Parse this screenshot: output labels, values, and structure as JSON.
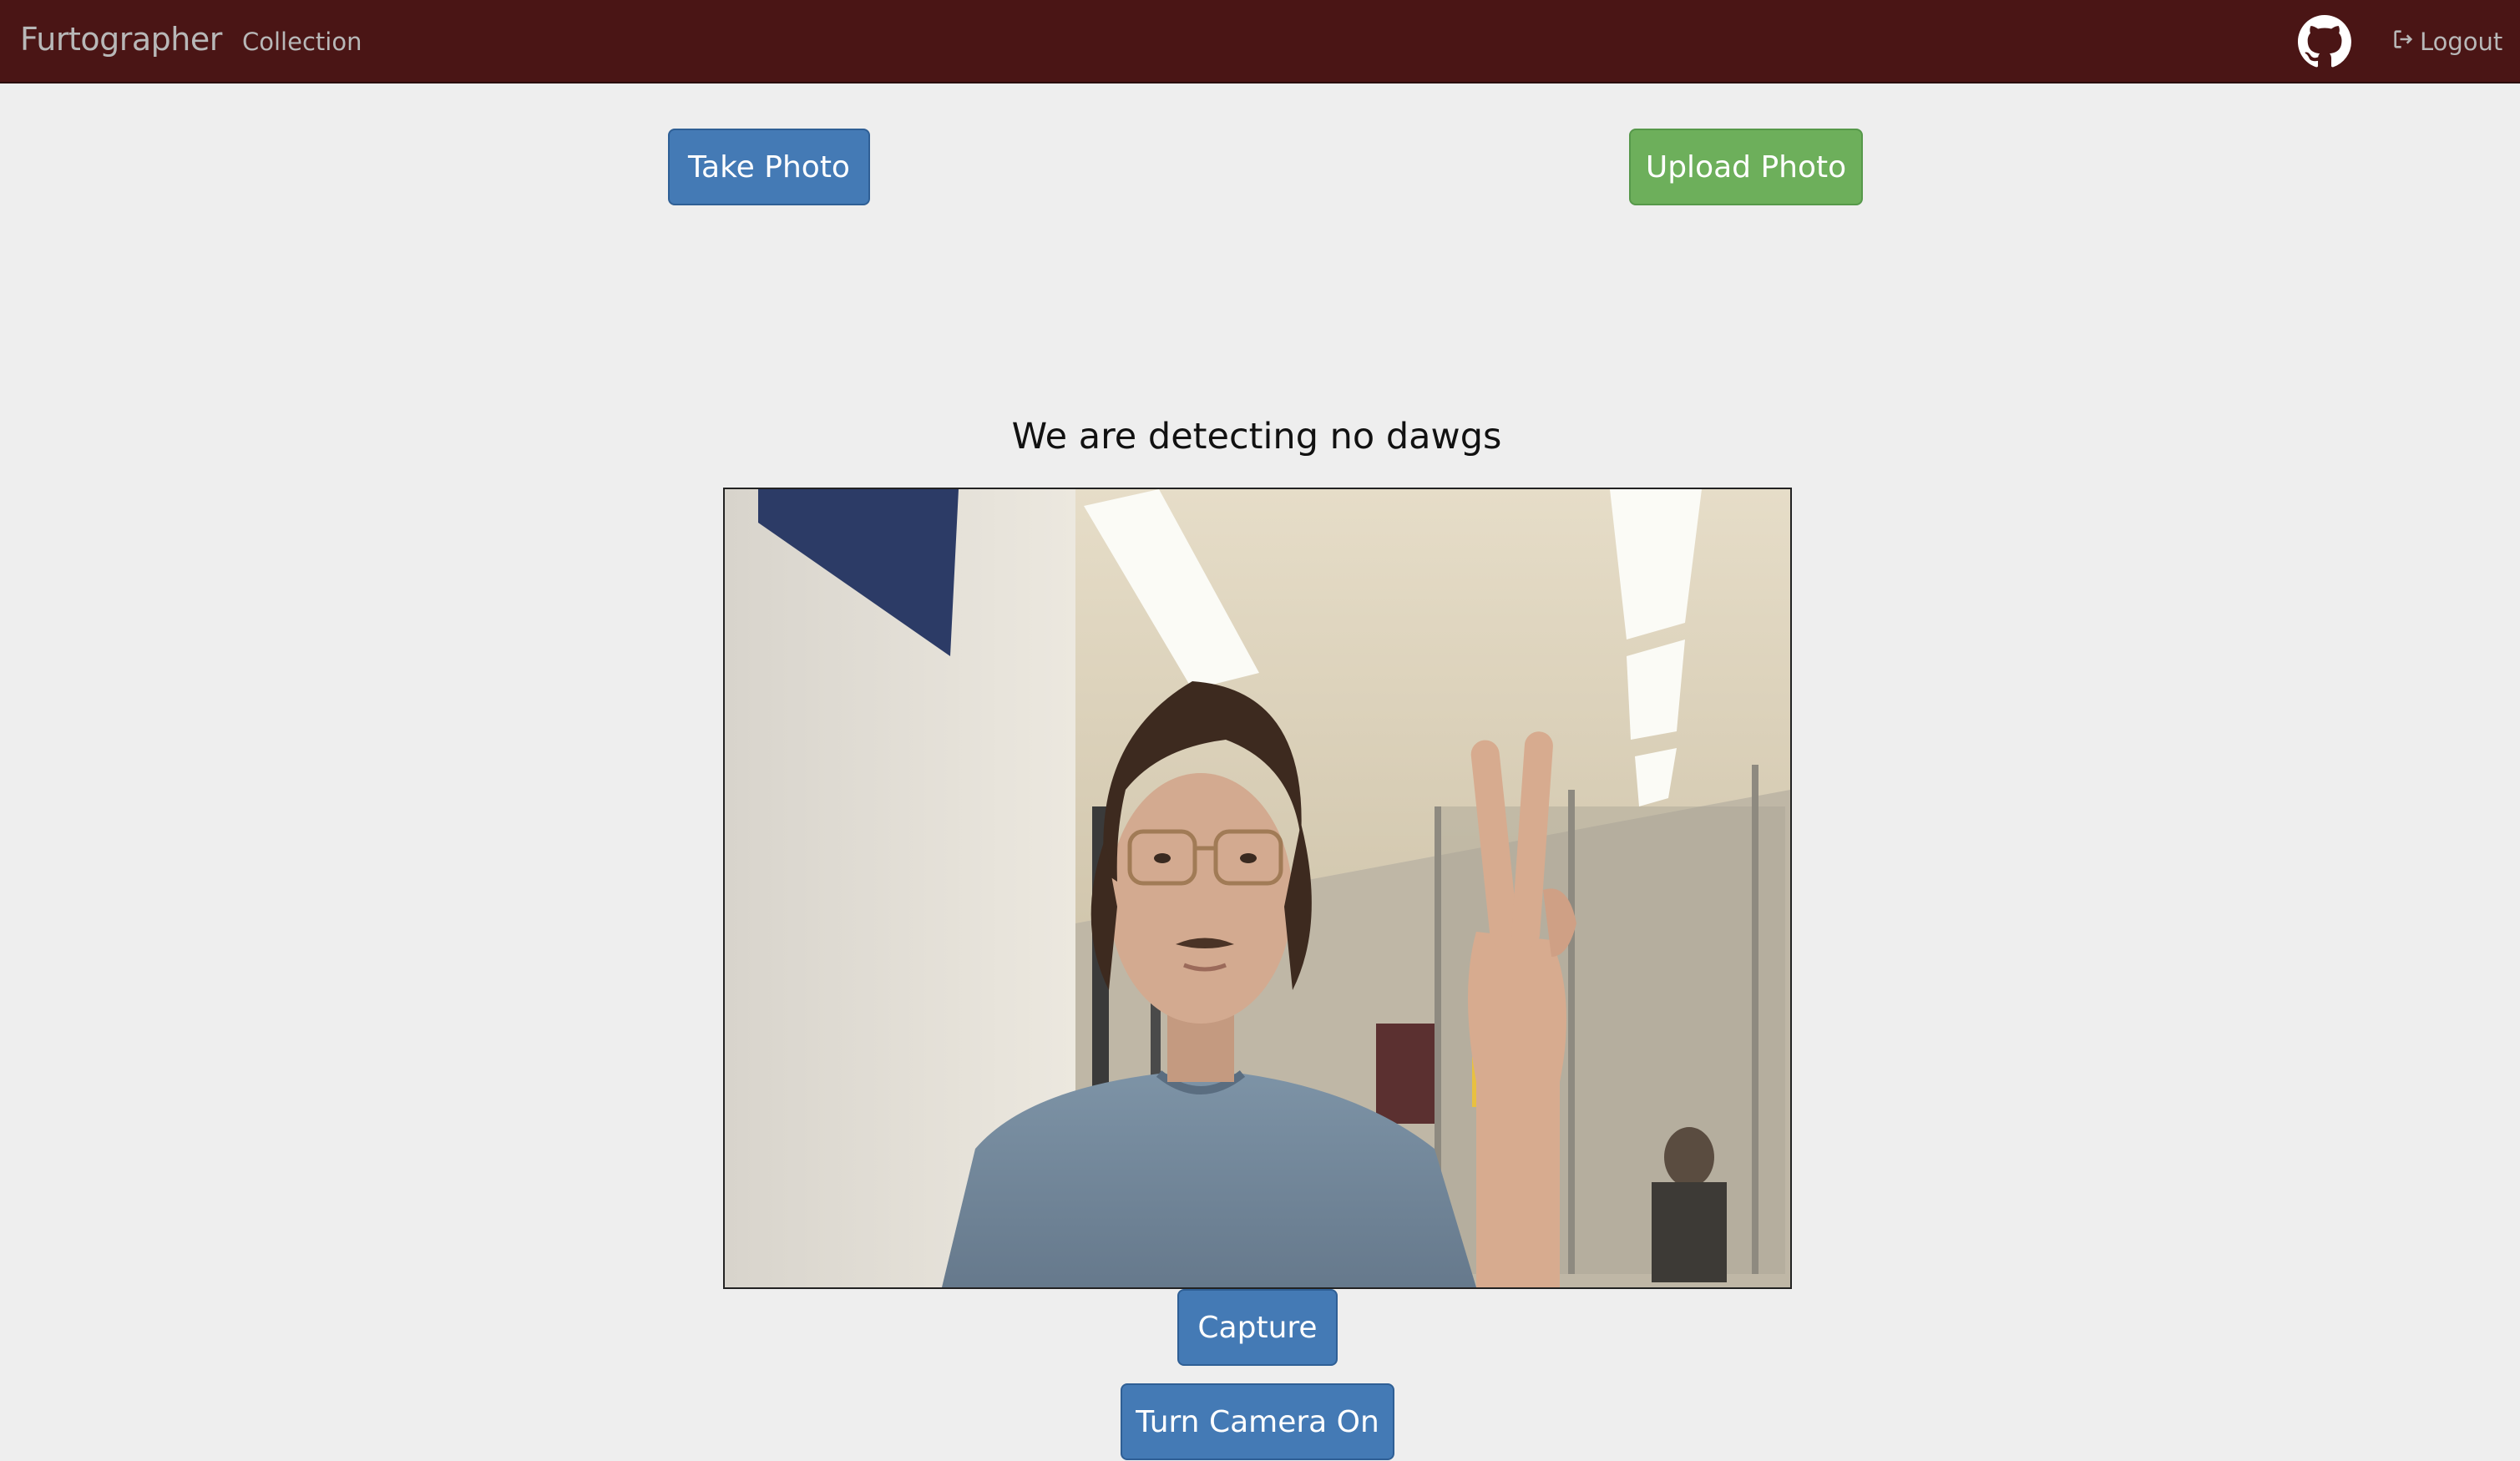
{
  "navbar": {
    "brand": "Furtographer",
    "links": [
      {
        "label": "Collection"
      }
    ],
    "github_icon": "github-icon",
    "logout_label": "Logout",
    "logout_icon": "logout-icon"
  },
  "actions": {
    "take_photo_label": "Take Photo",
    "upload_photo_label": "Upload Photo"
  },
  "detection": {
    "status_text": "We are detecting no dawgs"
  },
  "camera": {
    "capture_label": "Capture",
    "turn_on_label": "Turn Camera On"
  },
  "colors": {
    "navbar_bg": "#4a1515",
    "primary": "#447ab5",
    "success": "#6daf5b",
    "page_bg": "#eeeeee"
  }
}
